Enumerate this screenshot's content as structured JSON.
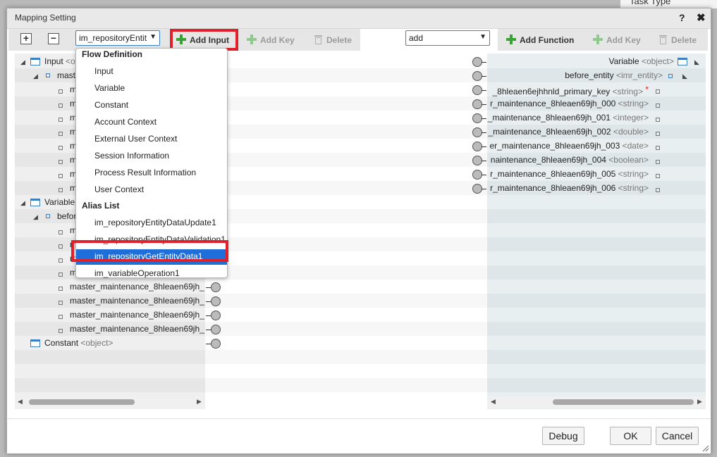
{
  "background": {
    "task_type_label": "Task Type"
  },
  "dialog": {
    "title": "Mapping Setting",
    "help_label": "?",
    "close_label": "✖"
  },
  "toolbar": {
    "expand_label": "+",
    "collapse_label": "−",
    "input_select_value": "im_repositoryEntit",
    "add_input_label": "Add Input",
    "add_key_left_label": "Add Key",
    "delete_left_label": "Delete",
    "function_select_value": "add",
    "add_function_label": "Add Function",
    "add_key_right_label": "Add Key",
    "delete_right_label": "Delete"
  },
  "dropdown": {
    "groups": [
      {
        "label": "Flow Definition",
        "items": [
          "Input",
          "Variable",
          "Constant",
          "Account Context",
          "External User Context",
          "Session Information",
          "Process Result Information",
          "User Context"
        ]
      },
      {
        "label": "Alias List",
        "items": [
          "im_repositoryEntityDataUpdate1",
          "im_repositoryEntityDataValidation1",
          "im_repositoryGetEntityData1",
          "im_variableOperation1"
        ]
      }
    ],
    "selected": "im_repositoryGetEntityData1"
  },
  "left_tree": {
    "input": {
      "label": "Input",
      "type": "<o"
    },
    "input_child": {
      "label": "mast"
    },
    "input_leaves": [
      "m",
      "m",
      "m",
      "m",
      "m",
      "m",
      "m",
      "m"
    ],
    "variable": {
      "label": "Variable"
    },
    "variable_child": {
      "label": "befor"
    },
    "variable_leaves": [
      "m",
      "m",
      "m",
      "m",
      "master_maintenance_8hleaen69jh_",
      "master_maintenance_8hleaen69jh_",
      "master_maintenance_8hleaen69jh_",
      "master_maintenance_8hleaen69jh_"
    ],
    "constant": {
      "label": "Constant",
      "type": "<object>"
    }
  },
  "right_tree": {
    "variable": {
      "label": "Variable",
      "type": "<object>"
    },
    "before_entity": {
      "label": "before_entity",
      "type": "<imr_entity>"
    },
    "leaves": [
      {
        "label": "_8hleaen6ejhhnld_primary_key",
        "type": "<string>",
        "required": "*"
      },
      {
        "label": "r_maintenance_8hleaen69jh_000",
        "type": "<string>"
      },
      {
        "label": "_maintenance_8hleaen69jh_001",
        "type": "<integer>"
      },
      {
        "label": "_maintenance_8hleaen69jh_002",
        "type": "<double>"
      },
      {
        "label": "er_maintenance_8hleaen69jh_003",
        "type": "<date>"
      },
      {
        "label": "naintenance_8hleaen69jh_004",
        "type": "<boolean>"
      },
      {
        "label": "r_maintenance_8hleaen69jh_005",
        "type": "<string>"
      },
      {
        "label": "r_maintenance_8hleaen69jh_006",
        "type": "<string>"
      }
    ]
  },
  "footer": {
    "debug_label": "Debug",
    "ok_label": "OK",
    "cancel_label": "Cancel"
  }
}
